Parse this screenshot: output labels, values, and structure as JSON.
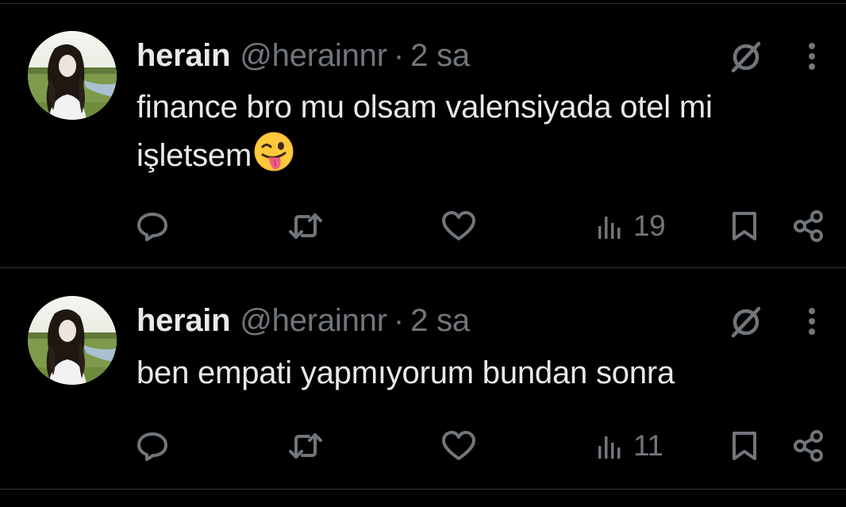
{
  "colors": {
    "background": "#000000",
    "primary_text": "#e7e9ea",
    "secondary_text": "#71767b",
    "divider": "#2f3336"
  },
  "tweets": [
    {
      "display_name": "herain",
      "handle": "@herainnr",
      "separator": "·",
      "time": "2 sa",
      "text": "finance bro mu olsam valensiyada otel mi işletsem",
      "emoji": "winking-face-with-tongue",
      "views": "19",
      "icons": {
        "grok": "grok-icon",
        "more": "more-vertical-icon",
        "reply": "reply-icon",
        "retweet": "retweet-icon",
        "like": "heart-icon",
        "views": "views-chart-icon",
        "bookmark": "bookmark-icon",
        "share": "share-icon"
      }
    },
    {
      "display_name": "herain",
      "handle": "@herainnr",
      "separator": "·",
      "time": "2 sa",
      "text": "ben empati yapmıyorum bundan sonra",
      "views": "11",
      "icons": {
        "grok": "grok-icon",
        "more": "more-vertical-icon",
        "reply": "reply-icon",
        "retweet": "retweet-icon",
        "like": "heart-icon",
        "views": "views-chart-icon",
        "bookmark": "bookmark-icon",
        "share": "share-icon"
      }
    }
  ]
}
